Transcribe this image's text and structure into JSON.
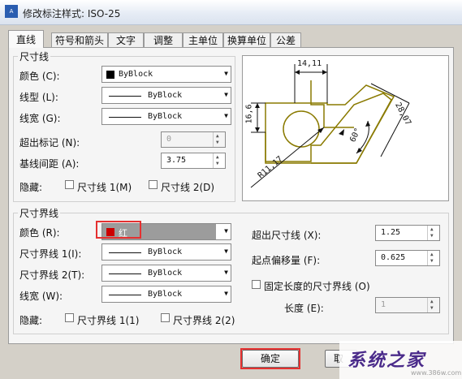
{
  "window": {
    "title": "修改标注样式: ISO-25"
  },
  "tabs": [
    {
      "label": "直线"
    },
    {
      "label": "符号和箭头"
    },
    {
      "label": "文字"
    },
    {
      "label": "调整"
    },
    {
      "label": "主单位"
    },
    {
      "label": "换算单位"
    },
    {
      "label": "公差"
    }
  ],
  "dim_lines": {
    "group_title": "尺寸线",
    "color_label": "颜色 (C):",
    "color_value": "ByBlock",
    "linetype_label": "线型 (L):",
    "linetype_value": "ByBlock",
    "lineweight_label": "线宽 (G):",
    "lineweight_value": "ByBlock",
    "extend_label": "超出标记 (N):",
    "extend_value": "0",
    "baseline_label": "基线间距 (A):",
    "baseline_value": "3.75",
    "suppress_label": "隐藏:",
    "suppress1_label": "尺寸线 1(M)",
    "suppress2_label": "尺寸线 2(D)"
  },
  "ext_lines": {
    "group_title": "尺寸界线",
    "color_label": "颜色 (R):",
    "color_value": "红",
    "ext1_label": "尺寸界线 1(I):",
    "ext1_value": "ByBlock",
    "ext2_label": "尺寸界线 2(T):",
    "ext2_value": "ByBlock",
    "lineweight_label": "线宽 (W):",
    "lineweight_value": "ByBlock",
    "suppress_label": "隐藏:",
    "suppress1_label": "尺寸界线 1(1)",
    "suppress2_label": "尺寸界线 2(2)",
    "beyond_label": "超出尺寸线 (X):",
    "beyond_value": "1.25",
    "offset_label": "起点偏移量 (F):",
    "offset_value": "0.625",
    "fixed_label": "固定长度的尺寸界线 (O)",
    "length_label": "长度 (E):",
    "length_value": "1"
  },
  "preview": {
    "dim_top": "14,11",
    "dim_left": "16,6",
    "dim_diag": "28,07",
    "angle": "60°",
    "radius": "R11,17"
  },
  "buttons": {
    "ok": "确定",
    "cancel_partial": "取"
  },
  "watermark": {
    "text": "系统之家",
    "url": "www.386w.com"
  },
  "colors": {
    "accent_red": "#e53030",
    "color_swatch_red": "#cc0000"
  }
}
